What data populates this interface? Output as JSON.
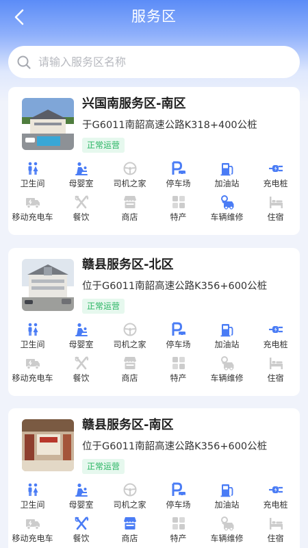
{
  "header": {
    "title": "服务区"
  },
  "search": {
    "placeholder": "请输入服务区名称"
  },
  "colors": {
    "active": "#4a7cf5",
    "inactive": "#cccccc",
    "status": "#27b361"
  },
  "areas": [
    {
      "name": "兴国南服务区-南区",
      "address": "于G6011南韶高速公路K318+400公桩",
      "status": "正常运营",
      "facilities": [
        {
          "label": "卫生间",
          "icon": "toilet-icon",
          "active": true
        },
        {
          "label": "母婴室",
          "icon": "mother-baby-icon",
          "active": true
        },
        {
          "label": "司机之家",
          "icon": "steering-wheel-icon",
          "active": false
        },
        {
          "label": "停车场",
          "icon": "parking-icon",
          "active": true
        },
        {
          "label": "加油站",
          "icon": "fuel-icon",
          "active": true
        },
        {
          "label": "充电桩",
          "icon": "charging-plug-icon",
          "active": true
        },
        {
          "label": "移动充电车",
          "icon": "truck-icon",
          "active": false
        },
        {
          "label": "餐饮",
          "icon": "utensils-icon",
          "active": false
        },
        {
          "label": "商店",
          "icon": "shop-icon",
          "active": false
        },
        {
          "label": "特产",
          "icon": "specialty-icon",
          "active": false
        },
        {
          "label": "车辆维修",
          "icon": "car-repair-icon",
          "active": true
        },
        {
          "label": "住宿",
          "icon": "bed-icon",
          "active": false
        }
      ]
    },
    {
      "name": "赣县服务区-北区",
      "address": "位于G6011南韶高速公路K356+600公桩",
      "status": "正常运营",
      "facilities": [
        {
          "label": "卫生间",
          "icon": "toilet-icon",
          "active": true
        },
        {
          "label": "母婴室",
          "icon": "mother-baby-icon",
          "active": true
        },
        {
          "label": "司机之家",
          "icon": "steering-wheel-icon",
          "active": false
        },
        {
          "label": "停车场",
          "icon": "parking-icon",
          "active": true
        },
        {
          "label": "加油站",
          "icon": "fuel-icon",
          "active": true
        },
        {
          "label": "充电桩",
          "icon": "charging-plug-icon",
          "active": true
        },
        {
          "label": "移动充电车",
          "icon": "truck-icon",
          "active": false
        },
        {
          "label": "餐饮",
          "icon": "utensils-icon",
          "active": false
        },
        {
          "label": "商店",
          "icon": "shop-icon",
          "active": false
        },
        {
          "label": "特产",
          "icon": "specialty-icon",
          "active": false
        },
        {
          "label": "车辆维修",
          "icon": "car-repair-icon",
          "active": false
        },
        {
          "label": "住宿",
          "icon": "bed-icon",
          "active": false
        }
      ]
    },
    {
      "name": "赣县服务区-南区",
      "address": "位于G6011南韶高速公路K356+600公桩",
      "status": "正常运营",
      "facilities": [
        {
          "label": "卫生间",
          "icon": "toilet-icon",
          "active": true
        },
        {
          "label": "母婴室",
          "icon": "mother-baby-icon",
          "active": true
        },
        {
          "label": "司机之家",
          "icon": "steering-wheel-icon",
          "active": false
        },
        {
          "label": "停车场",
          "icon": "parking-icon",
          "active": true
        },
        {
          "label": "加油站",
          "icon": "fuel-icon",
          "active": true
        },
        {
          "label": "充电桩",
          "icon": "charging-plug-icon",
          "active": true
        },
        {
          "label": "移动充电车",
          "icon": "truck-icon",
          "active": false
        },
        {
          "label": "餐饮",
          "icon": "utensils-icon",
          "active": true
        },
        {
          "label": "商店",
          "icon": "shop-icon",
          "active": true
        },
        {
          "label": "特产",
          "icon": "specialty-icon",
          "active": false
        },
        {
          "label": "车辆维修",
          "icon": "car-repair-icon",
          "active": false
        },
        {
          "label": "住宿",
          "icon": "bed-icon",
          "active": false
        }
      ]
    }
  ]
}
